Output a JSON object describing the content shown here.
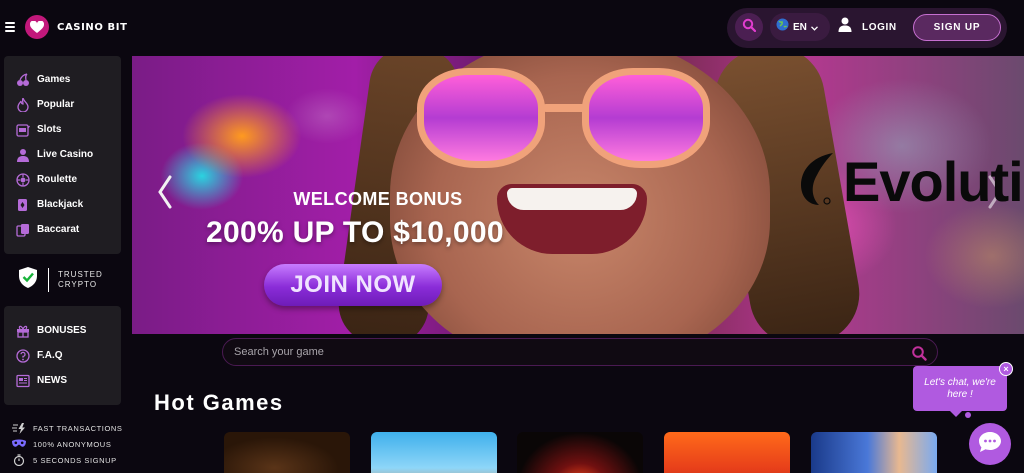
{
  "brand": {
    "name": "CASINO BIT"
  },
  "sidebar": {
    "items": [
      {
        "label": "Games",
        "icon": "cherries-icon"
      },
      {
        "label": "Popular",
        "icon": "flame-icon"
      },
      {
        "label": "Slots",
        "icon": "slot-machine-icon"
      },
      {
        "label": "Live Casino",
        "icon": "dealer-icon"
      },
      {
        "label": "Roulette",
        "icon": "roulette-icon"
      },
      {
        "label": "Blackjack",
        "icon": "cards-icon"
      },
      {
        "label": "Baccarat",
        "icon": "baccarat-icon"
      }
    ],
    "trusted": {
      "line1": "TRUSTED",
      "line2": "CRYPTO"
    },
    "secondary": [
      {
        "label": "BONUSES",
        "icon": "gift-icon"
      },
      {
        "label": "F.A.Q",
        "icon": "question-icon"
      },
      {
        "label": "NEWS",
        "icon": "newspaper-icon"
      }
    ],
    "features": [
      {
        "label": "FAST TRANSACTIONS",
        "icon": "lightning-icon"
      },
      {
        "label": "100% ANONYMOUS",
        "icon": "mask-icon"
      },
      {
        "label": "5 SECONDS SIGNUP",
        "icon": "stopwatch-icon"
      }
    ]
  },
  "header": {
    "language": "EN",
    "login_label": "LOGIN",
    "signup_label": "SIGN UP"
  },
  "banner": {
    "subtitle": "WELCOME BONUS",
    "headline": "200% UP TO $10,000",
    "cta": "JOIN NOW",
    "partner": "Evoluti"
  },
  "search": {
    "placeholder": "Search your game"
  },
  "hot_games": {
    "title": "Hot Games"
  },
  "chat": {
    "message": "Let's chat, we're here !",
    "close": "×"
  },
  "colors": {
    "accent": "#b05ae0",
    "brand": "#c2187b",
    "signup_border": "#c66fd0"
  }
}
